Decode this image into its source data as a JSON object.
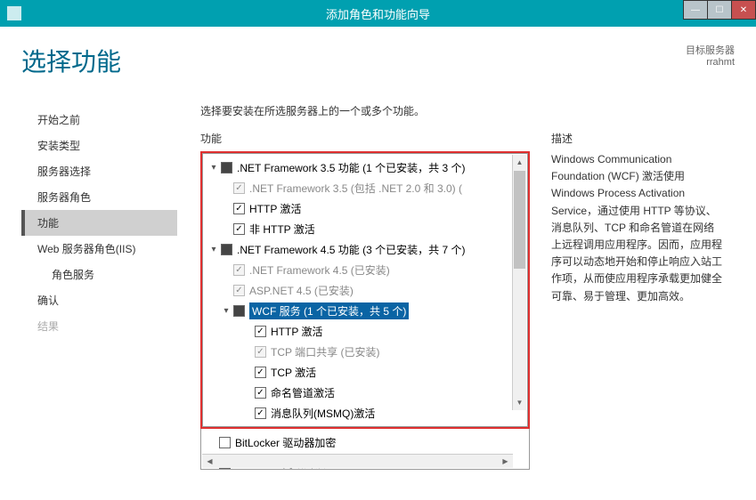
{
  "titlebar": {
    "title": "添加角色和功能向导"
  },
  "header": {
    "page_title": "选择功能",
    "server_label": "目标服务器",
    "server_name": "rrahmt"
  },
  "sidebar": {
    "items": [
      {
        "label": "开始之前",
        "active": false
      },
      {
        "label": "安装类型",
        "active": false
      },
      {
        "label": "服务器选择",
        "active": false
      },
      {
        "label": "服务器角色",
        "active": false
      },
      {
        "label": "功能",
        "active": true
      },
      {
        "label": "Web 服务器角色(IIS)",
        "active": false
      },
      {
        "label": "角色服务",
        "active": false,
        "indent": true
      },
      {
        "label": "确认",
        "active": false
      },
      {
        "label": "结果",
        "active": false,
        "disabled": true
      }
    ]
  },
  "main": {
    "instruction": "选择要安装在所选服务器上的一个或多个功能。",
    "tree_label": "功能",
    "desc_label": "描述",
    "description": "Windows Communication Foundation (WCF) 激活使用 Windows Process Activation Service，通过使用 HTTP 等协议、消息队列、TCP 和命名管道在网络上远程调用应用程序。因而，应用程序可以动态地开始和停止响应入站工作项，从而使应用程序承载更加健全可靠、易于管理、更加高效。"
  },
  "tree": [
    {
      "level": 0,
      "exp": "▾",
      "chk": "mixed",
      "label": ".NET Framework 3.5 功能 (1 个已安装，共 3 个)"
    },
    {
      "level": 1,
      "exp": "",
      "chk": "greychecked disabled",
      "label": ".NET Framework 3.5 (包括 .NET 2.0 和 3.0) (",
      "grey": true
    },
    {
      "level": 1,
      "exp": "",
      "chk": "checked",
      "label": "HTTP 激活"
    },
    {
      "level": 1,
      "exp": "",
      "chk": "checked",
      "label": "非 HTTP 激活"
    },
    {
      "level": 0,
      "exp": "▾",
      "chk": "mixed",
      "label": ".NET Framework 4.5 功能 (3 个已安装，共 7 个)"
    },
    {
      "level": 1,
      "exp": "",
      "chk": "greychecked disabled",
      "label": ".NET Framework 4.5 (已安装)",
      "grey": true
    },
    {
      "level": 1,
      "exp": "",
      "chk": "greychecked disabled",
      "label": "ASP.NET 4.5 (已安装)",
      "grey": true
    },
    {
      "level": 1,
      "exp": "▾",
      "chk": "mixed",
      "label": "WCF 服务 (1 个已安装，共 5 个)",
      "selected": true
    },
    {
      "level": 2,
      "exp": "",
      "chk": "checked",
      "label": "HTTP 激活"
    },
    {
      "level": 2,
      "exp": "",
      "chk": "greychecked disabled",
      "label": "TCP 端口共享 (已安装)",
      "grey": true
    },
    {
      "level": 2,
      "exp": "",
      "chk": "checked",
      "label": "TCP 激活"
    },
    {
      "level": 2,
      "exp": "",
      "chk": "checked",
      "label": "命名管道激活"
    },
    {
      "level": 2,
      "exp": "",
      "chk": "checked",
      "label": "消息队列(MSMQ)激活"
    }
  ],
  "extra": [
    {
      "level": 0,
      "exp": "",
      "chk": "",
      "label": "BitLocker 驱动器加密"
    },
    {
      "level": 0,
      "exp": "",
      "chk": "",
      "label": "BitLocker 网络解锁"
    }
  ]
}
